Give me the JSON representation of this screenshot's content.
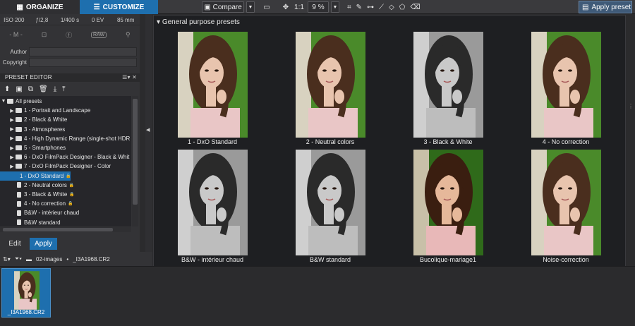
{
  "tabs": {
    "organize": "ORGANIZE",
    "customize": "CUSTOMIZE"
  },
  "toolbar": {
    "compare": "Compare",
    "zoom_ratio": "1:1",
    "zoom_percent": "9 %",
    "apply_preset": "Apply preset"
  },
  "exif": [
    "ISO 200",
    "ƒ/2,8",
    "1/400 s",
    "0 EV",
    "85 mm"
  ],
  "exif_icons": {
    "mode": "- M -",
    "raw": "RAW"
  },
  "metadata": {
    "author_label": "Author",
    "copyright_label": "Copyright"
  },
  "preset_editor": {
    "title": "PRESET EDITOR",
    "header_icons": "☰▾ ✕",
    "tree": [
      {
        "label": "All presets",
        "kind": "folder-open"
      },
      {
        "label": "1 - Portrait and Landscape",
        "kind": "folder"
      },
      {
        "label": "2 - Black & White",
        "kind": "folder"
      },
      {
        "label": "3 - Atmospheres",
        "kind": "folder"
      },
      {
        "label": "4 - High Dynamic Range (single-shot HDR",
        "kind": "folder"
      },
      {
        "label": "5 - Smartphones",
        "kind": "folder"
      },
      {
        "label": "6 - DxO FilmPack Designer - Black & Whit",
        "kind": "folder"
      },
      {
        "label": "7 - DxO FilmPack Designer - Color",
        "kind": "folder"
      },
      {
        "label": "1 - DxO Standard",
        "kind": "doc-locked",
        "selected": true
      },
      {
        "label": "2 - Neutral colors",
        "kind": "doc-locked"
      },
      {
        "label": "3 - Black & White",
        "kind": "doc-locked"
      },
      {
        "label": "4 - No correction",
        "kind": "doc-locked"
      },
      {
        "label": "B&W - intérieur chaud",
        "kind": "doc"
      },
      {
        "label": "B&W standard",
        "kind": "doc"
      }
    ],
    "edit": "Edit",
    "apply": "Apply"
  },
  "presets": {
    "group_title": "General purpose presets",
    "items": [
      {
        "label": "1 - DxO Standard",
        "style": "color"
      },
      {
        "label": "2 - Neutral colors",
        "style": "color"
      },
      {
        "label": "3 - Black & White",
        "style": "bw"
      },
      {
        "label": "4 - No correction",
        "style": "color"
      },
      {
        "label": "B&W - intérieur chaud",
        "style": "bw"
      },
      {
        "label": "B&W standard",
        "style": "bw"
      },
      {
        "label": "Bucolique-mariage1",
        "style": "vivid"
      },
      {
        "label": "Noise-correction",
        "style": "color"
      }
    ]
  },
  "filmstrip": {
    "path_folder": "02-images",
    "path_file": "_I3A1968.CR2",
    "separator": "•",
    "thumb_caption": "_I3A1968.CR2"
  },
  "colors": {
    "accent": "#1e6fae",
    "panel": "#1e1f22"
  }
}
